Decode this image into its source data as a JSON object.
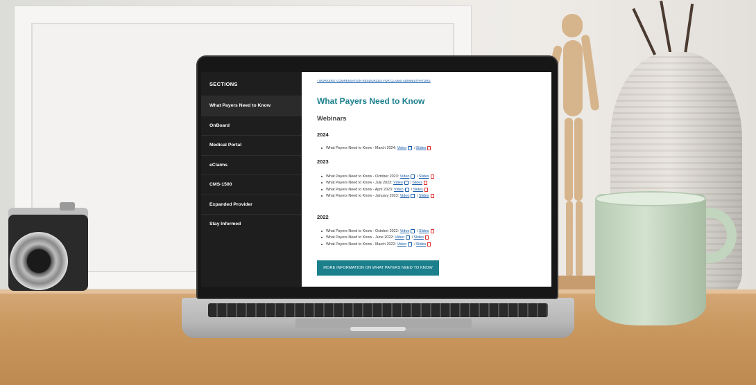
{
  "sidebar": {
    "header": "SECTIONS",
    "items": [
      {
        "label": "What Payers Need to Know",
        "active": true
      },
      {
        "label": "OnBoard",
        "active": false
      },
      {
        "label": "Medical Portal",
        "active": false
      },
      {
        "label": "eClaims",
        "active": false
      },
      {
        "label": "CMS-1500",
        "active": false
      },
      {
        "label": "Expanded Provider",
        "active": false
      },
      {
        "label": "Stay Informed",
        "active": false
      }
    ]
  },
  "main": {
    "breadcrumb": "‹ WORKERS' COMPENSATION RESOURCES FOR CLAIMS ADMINISTRATORS",
    "title": "What Payers Need to Know",
    "section_title": "Webinars",
    "video_label": "Video",
    "slides_label": "Slides",
    "separator": "/",
    "groups": [
      {
        "year": "2024",
        "items": [
          "What Payers Need to Know - March 2024:"
        ]
      },
      {
        "year": "2023",
        "items": [
          "What Payers Need to Know - October 2023:",
          "What Payers Need to Know - July 2023:",
          "What Payers Need to Know - April 2023:",
          "What Payers Need to Know - January 2023:"
        ]
      },
      {
        "year": "2022",
        "items": [
          "What Payers Need to Know - October 2022:",
          "What Payers Need to Know - June 2022:",
          "What Payers Need to Know - March 2022:"
        ]
      }
    ],
    "more_button": "MORE INFORMATION ON WHAT PAYERS NEED TO KNOW"
  },
  "colors": {
    "accent": "#1b7f8c",
    "link": "#1b5fa8",
    "sidebar_bg": "#1e1e1e",
    "pdf_icon": "#dd3333"
  },
  "icons": {
    "external_link": "external-link-icon",
    "pdf": "pdf-icon"
  }
}
